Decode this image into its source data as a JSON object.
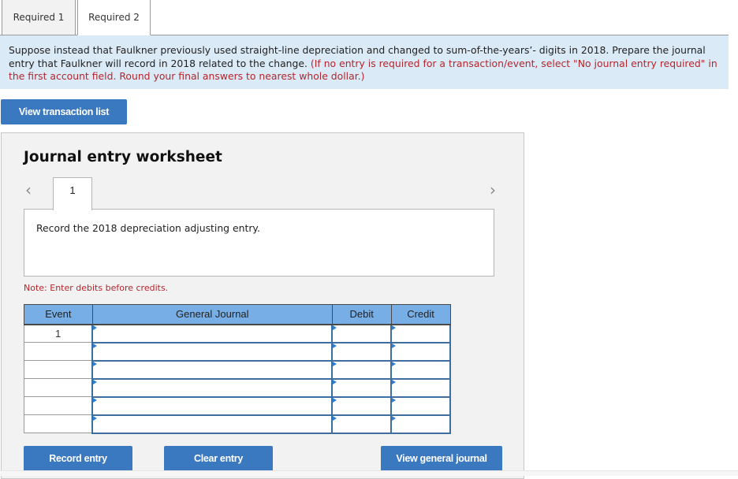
{
  "tabs": [
    {
      "label": "Required 1",
      "active": false
    },
    {
      "label": "Required 2",
      "active": true
    }
  ],
  "instructions": {
    "main": "Suppose instead that Faulkner previously used straight-line depreciation and changed to sum-of-the-years’- digits in 2018. Prepare the journal entry that Faulkner will record in 2018 related to the change.",
    "note": "(If no entry is required for a transaction/event, select \"No journal entry required\" in the first account field. Round your final answers to nearest whole dollar.)"
  },
  "buttons": {
    "view_transaction_list": "View transaction list",
    "record_entry": "Record entry",
    "clear_entry": "Clear entry",
    "view_general_journal": "View general journal"
  },
  "worksheet": {
    "title": "Journal entry worksheet",
    "prev_icon": "chevron-left-icon",
    "next_icon": "chevron-right-icon",
    "prev_glyph": "‹",
    "next_glyph": "›",
    "current_page": "1",
    "description": "Record the 2018 depreciation adjusting entry.",
    "note": "Note: Enter debits before credits."
  },
  "table": {
    "headers": [
      "Event",
      "General Journal",
      "Debit",
      "Credit"
    ],
    "rows": [
      {
        "event": "1",
        "account": "",
        "debit": "",
        "credit": ""
      },
      {
        "event": "",
        "account": "",
        "debit": "",
        "credit": ""
      },
      {
        "event": "",
        "account": "",
        "debit": "",
        "credit": ""
      },
      {
        "event": "",
        "account": "",
        "debit": "",
        "credit": ""
      },
      {
        "event": "",
        "account": "",
        "debit": "",
        "credit": ""
      },
      {
        "event": "",
        "account": "",
        "debit": "",
        "credit": ""
      }
    ]
  },
  "colors": {
    "accent_button": "#3a78bf",
    "table_header": "#78aee6",
    "instruction_bg": "#dbeaf7",
    "note_red": "#b4262c"
  }
}
